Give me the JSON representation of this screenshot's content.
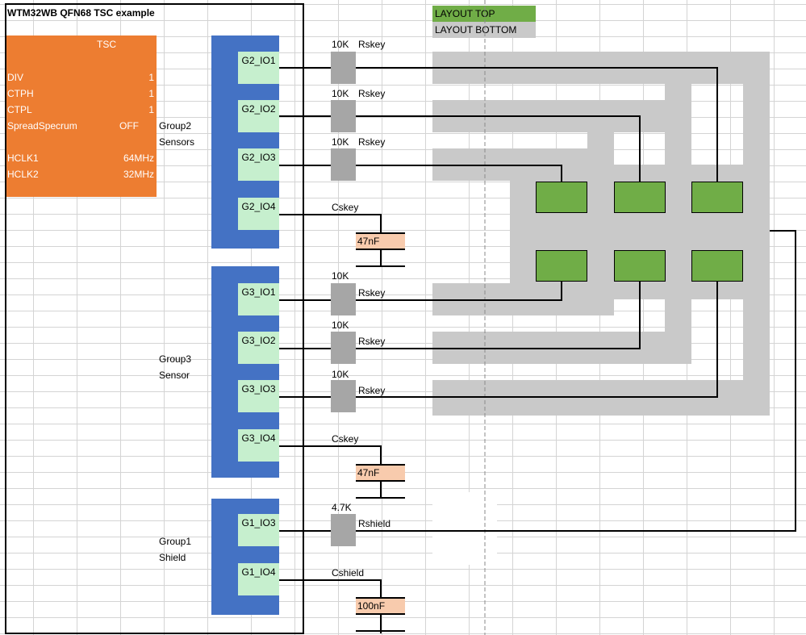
{
  "title": "WTM32WB QFN68 TSC example",
  "tsc": {
    "header": "TSC",
    "rows": [
      {
        "label": "DIV",
        "value": "1"
      },
      {
        "label": "CTPH",
        "value": "1"
      },
      {
        "label": "CTPL",
        "value": "1"
      },
      {
        "label": "SpreadSpecrum",
        "value": "OFF"
      },
      {
        "label": "HCLK1",
        "value": "64MHz"
      },
      {
        "label": "HCLK2",
        "value": "32MHz"
      }
    ]
  },
  "groups": {
    "group2": {
      "line1": "Group2",
      "line2": "Sensors"
    },
    "group3": {
      "line1": "Group3",
      "line2": "Sensor"
    },
    "group1": {
      "line1": "Group1",
      "line2": "Shield"
    }
  },
  "pins": [
    "G2_IO1",
    "G2_IO2",
    "G2_IO3",
    "G2_IO4",
    "G3_IO1",
    "G3_IO2",
    "G3_IO3",
    "G3_IO4",
    "G1_IO3",
    "G1_IO4"
  ],
  "components": {
    "r_value": "10K",
    "r_name": "Rskey",
    "c_name": "Cskey",
    "c_value": "47nF",
    "shield_r_value": "4.7K",
    "shield_r_name": "Rshield",
    "shield_c_name": "Cshield",
    "shield_c_value": "100nF"
  },
  "legend": {
    "top": "LAYOUT TOP",
    "bottom": "LAYOUT BOTTOM",
    "top_color": "#70ad47",
    "bottom_color": "#c9c9c9"
  },
  "colors": {
    "tsc_panel": "#ed7d31",
    "pin_block": "#4472c4",
    "pin_cell": "#c6efce",
    "resistor": "#a6a6a6",
    "capacitor": "#f8cbad"
  }
}
